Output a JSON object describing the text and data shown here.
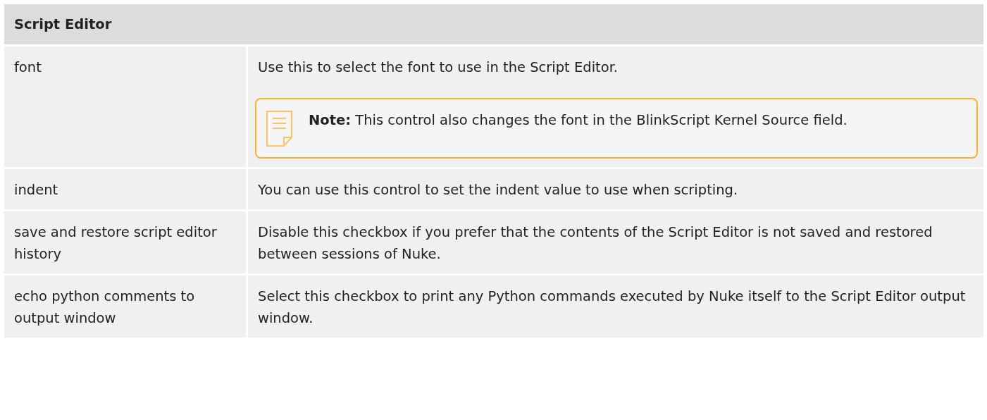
{
  "table": {
    "title": "Script Editor",
    "rows": [
      {
        "name": "font",
        "description": "Use this to select the font to use in the Script Editor.",
        "note": "**Note:**  This control also changes the font in the BlinkScript Kernel Source field."
      },
      {
        "name": "indent",
        "description": "You can use this control to set the indent value to use when scripting."
      },
      {
        "name": "save and restore script editor history",
        "description": "Disable this checkbox if you prefer that the contents of the Script Editor is not saved and restored between sessions of Nuke."
      },
      {
        "name": "echo python comments to output window",
        "description": "Select this checkbox to print any Python commands executed by Nuke itself to the Script Editor output window."
      }
    ]
  }
}
